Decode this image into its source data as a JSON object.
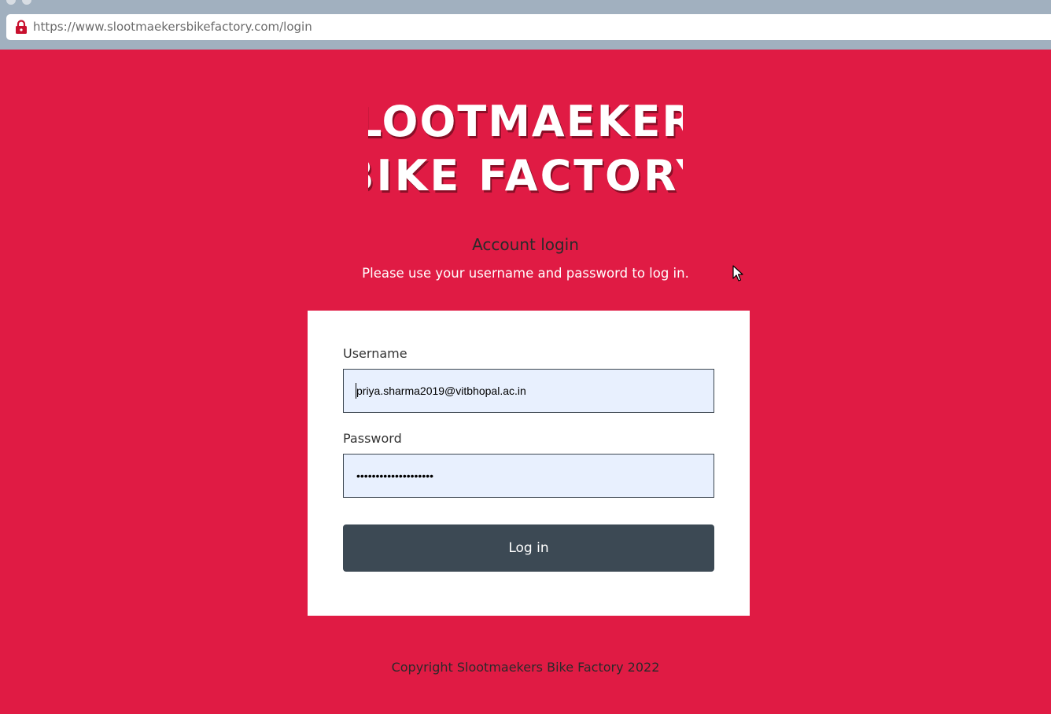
{
  "browser": {
    "url": "https://www.slootmaekersbikefactory.com/login"
  },
  "logo": {
    "line1": "SLOOTMAEKERS",
    "line2": "BIKE FACTORY"
  },
  "login": {
    "heading": "Account login",
    "subheading": "Please use your username and password to log in.",
    "username_label": "Username",
    "username_value": "priya.sharma2019@vitbhopal.ac.in",
    "password_label": "Password",
    "password_value": "••••••••••••••••••••",
    "submit_label": "Log in"
  },
  "footer": {
    "copyright": "Copyright Slootmaekers Bike Factory 2022"
  },
  "colors": {
    "page_background": "#e01b44",
    "button_background": "#3c4954",
    "input_background": "#e8f0fe",
    "browser_chrome": "#a1b0bf"
  },
  "icons": {
    "secure_connection": "lock-icon",
    "pointer": "cursor-icon"
  }
}
